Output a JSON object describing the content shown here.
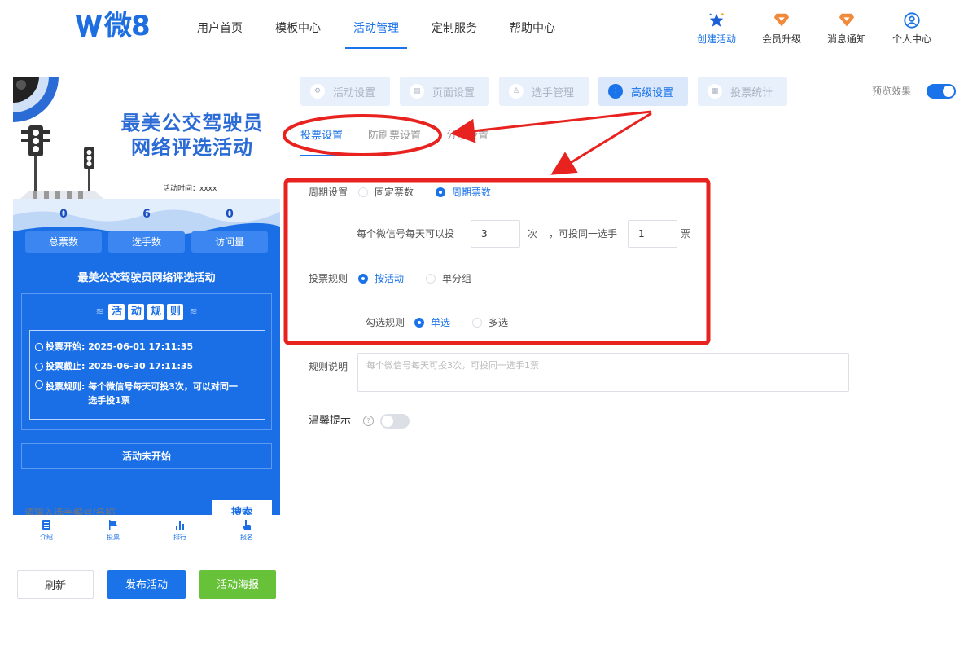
{
  "nav": {
    "logo": "微8",
    "menu": [
      {
        "label": "用户首页"
      },
      {
        "label": "模板中心"
      },
      {
        "label": "活动管理",
        "active": true
      },
      {
        "label": "定制服务"
      },
      {
        "label": "帮助中心"
      }
    ],
    "right": [
      {
        "label": "创建活动",
        "icon": "star-icon"
      },
      {
        "label": "会员升级",
        "icon": "diamond-icon"
      },
      {
        "label": "消息通知",
        "icon": "diamond-icon"
      },
      {
        "label": "个人中心",
        "icon": "user-icon"
      }
    ]
  },
  "phone": {
    "title_line1": "最美公交驾驶员",
    "title_line2": "网络评选活动",
    "activity_time": "活动时间：xxxx",
    "stats": [
      {
        "value": "0",
        "label": "总票数"
      },
      {
        "value": "6",
        "label": "选手数"
      },
      {
        "value": "0",
        "label": "访问量"
      }
    ],
    "activity_name": "最美公交驾驶员网络评选活动",
    "rules_title_chars": [
      "活",
      "动",
      "规",
      "则"
    ],
    "rules": [
      {
        "label": "投票开始:",
        "value": "2025-06-01 17:11:35"
      },
      {
        "label": "投票截止:",
        "value": "2025-06-30 17:11:35"
      },
      {
        "label": "投票规则:",
        "value": "每个微信号每天可投3次，可以对同一选手投1票"
      }
    ],
    "status": "活动未开始",
    "search_placeholder": "请输入选手编号/名称",
    "search_button": "搜索",
    "tabbar": [
      {
        "label": "介绍",
        "icon": "document-icon"
      },
      {
        "label": "投票",
        "icon": "flag-icon"
      },
      {
        "label": "排行",
        "icon": "bar-chart-icon"
      },
      {
        "label": "报名",
        "icon": "hand-icon"
      }
    ]
  },
  "buttons": {
    "refresh": "刷新",
    "publish": "发布活动",
    "poster": "活动海报"
  },
  "steps": [
    {
      "label": "活动设置"
    },
    {
      "label": "页面设置"
    },
    {
      "label": "选手管理"
    },
    {
      "label": "高级设置",
      "active": true
    },
    {
      "label": "投票统计"
    }
  ],
  "preview_label": "预览效果",
  "preview_on": true,
  "subtabs": [
    {
      "label": "投票设置",
      "active": true
    },
    {
      "label": "防刷票设置"
    },
    {
      "label": "分享设置"
    }
  ],
  "form": {
    "cycle_label": "周期设置",
    "cycle_options": [
      {
        "label": "固定票数",
        "checked": false
      },
      {
        "label": "周期票数",
        "checked": true
      }
    ],
    "daily_text": "每个微信号每天可以投",
    "daily_value": "3",
    "times_unit": "次",
    "same_text": "，可投同一选手",
    "same_value": "1",
    "votes_unit": "票",
    "vote_rule_label": "投票规则",
    "vote_rule_options": [
      {
        "label": "按活动",
        "checked": true
      },
      {
        "label": "单分组",
        "checked": false
      }
    ],
    "select_rule_label": "勾选规则",
    "select_rule_options": [
      {
        "label": "单选",
        "checked": true
      },
      {
        "label": "多选",
        "checked": false
      }
    ],
    "desc_label": "规则说明",
    "desc_placeholder": "每个微信号每天可投3次，可投同一选手1票",
    "tip_label": "温馨提示",
    "tip_on": false
  },
  "colors": {
    "accent": "#1a73e8",
    "annotation": "#e8231f",
    "phone_bg": "#1a6fe6",
    "green": "#67c23a"
  }
}
